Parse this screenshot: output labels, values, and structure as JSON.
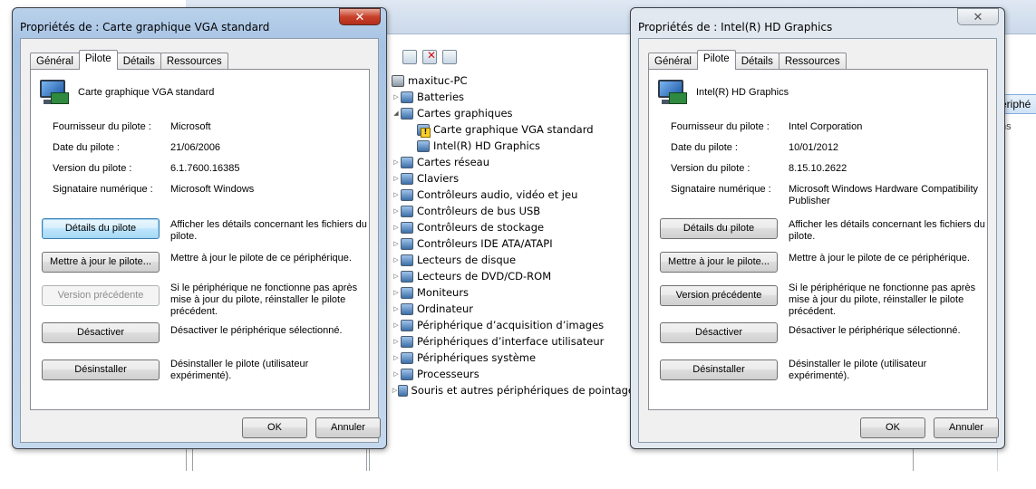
{
  "device_manager": {
    "computer": "maxituc-PC",
    "right_pane_item": "ériphé",
    "right_pane_sub": "ns",
    "tree": [
      {
        "label": "Batteries",
        "level": 1,
        "expanded": false,
        "warn": false
      },
      {
        "label": "Cartes graphiques",
        "level": 1,
        "expanded": true,
        "warn": false
      },
      {
        "label": "Carte graphique VGA standard",
        "level": 2,
        "expanded": null,
        "warn": true
      },
      {
        "label": "Intel(R) HD Graphics",
        "level": 2,
        "expanded": null,
        "warn": false
      },
      {
        "label": "Cartes réseau",
        "level": 1,
        "expanded": false,
        "warn": false
      },
      {
        "label": "Claviers",
        "level": 1,
        "expanded": false,
        "warn": false
      },
      {
        "label": "Contrôleurs audio, vidéo et jeu",
        "level": 1,
        "expanded": false,
        "warn": false
      },
      {
        "label": "Contrôleurs de bus USB",
        "level": 1,
        "expanded": false,
        "warn": false
      },
      {
        "label": "Contrôleurs de stockage",
        "level": 1,
        "expanded": false,
        "warn": false
      },
      {
        "label": "Contrôleurs IDE ATA/ATAPI",
        "level": 1,
        "expanded": false,
        "warn": false
      },
      {
        "label": "Lecteurs de disque",
        "level": 1,
        "expanded": false,
        "warn": false
      },
      {
        "label": "Lecteurs de DVD/CD-ROM",
        "level": 1,
        "expanded": false,
        "warn": false
      },
      {
        "label": "Moniteurs",
        "level": 1,
        "expanded": false,
        "warn": false
      },
      {
        "label": "Ordinateur",
        "level": 1,
        "expanded": false,
        "warn": false
      },
      {
        "label": "Périphérique d’acquisition d’images",
        "level": 1,
        "expanded": false,
        "warn": false
      },
      {
        "label": "Périphériques d’interface utilisateur",
        "level": 1,
        "expanded": false,
        "warn": false
      },
      {
        "label": "Périphériques système",
        "level": 1,
        "expanded": false,
        "warn": false
      },
      {
        "label": "Processeurs",
        "level": 1,
        "expanded": false,
        "warn": false
      },
      {
        "label": "Souris et autres périphériques de pointage",
        "level": 1,
        "expanded": false,
        "warn": false
      }
    ]
  },
  "dialog_vga": {
    "title": "Propriétés de : Carte graphique VGA standard",
    "close": "✕",
    "tabs": [
      "Général",
      "Pilote",
      "Détails",
      "Ressources"
    ],
    "device_name": "Carte graphique VGA standard",
    "labels": {
      "provider": "Fournisseur du pilote :",
      "date": "Date du pilote :",
      "version": "Version du pilote :",
      "signer": "Signataire numérique :"
    },
    "values": {
      "provider": "Microsoft",
      "date": "21/06/2006",
      "version": "6.1.7600.16385",
      "signer": "Microsoft Windows"
    },
    "buttons": {
      "details": "Détails du pilote",
      "update": "Mettre à jour le pilote...",
      "rollback": "Version précédente",
      "disable": "Désactiver",
      "uninstall": "Désinstaller",
      "ok": "OK",
      "cancel": "Annuler"
    },
    "descriptions": {
      "details": "Afficher les détails concernant les fichiers du pilote.",
      "update": "Mettre à jour le pilote de ce périphérique.",
      "rollback": "Si le périphérique ne fonctionne pas après mise à jour du pilote, réinstaller le pilote précédent.",
      "disable": "Désactiver le périphérique sélectionné.",
      "uninstall": "Désinstaller le pilote (utilisateur expérimenté)."
    }
  },
  "dialog_intel": {
    "title": "Propriétés de : Intel(R) HD Graphics",
    "close": "✕",
    "tabs": [
      "Général",
      "Pilote",
      "Détails",
      "Ressources"
    ],
    "device_name": "Intel(R) HD Graphics",
    "labels": {
      "provider": "Fournisseur du pilote :",
      "date": "Date du pilote :",
      "version": "Version du pilote :",
      "signer": "Signataire numérique :"
    },
    "values": {
      "provider": "Intel Corporation",
      "date": "10/01/2012",
      "version": "8.15.10.2622",
      "signer": "Microsoft Windows Hardware Compatibility Publisher"
    },
    "buttons": {
      "details": "Détails du pilote",
      "update": "Mettre à jour le pilote...",
      "rollback": "Version précédente",
      "disable": "Désactiver",
      "uninstall": "Désinstaller",
      "ok": "OK",
      "cancel": "Annuler"
    },
    "descriptions": {
      "details": "Afficher les détails concernant les fichiers du pilote.",
      "update": "Mettre à jour le pilote de ce périphérique.",
      "rollback": "Si le périphérique ne fonctionne pas après mise à jour du pilote, réinstaller le pilote précédent.",
      "disable": "Désactiver le périphérique sélectionné.",
      "uninstall": "Désinstaller le pilote (utilisateur expérimenté)."
    }
  }
}
